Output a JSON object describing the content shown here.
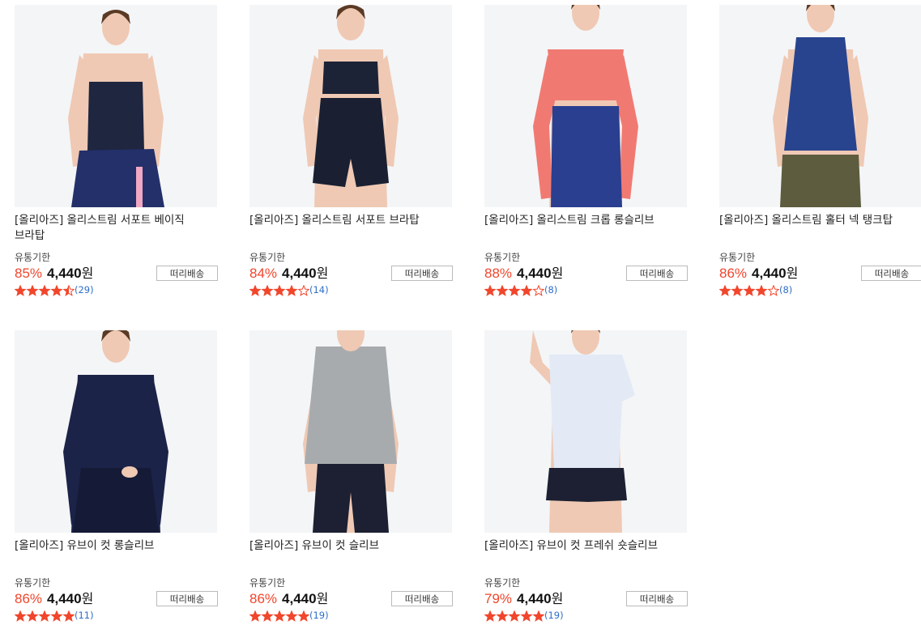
{
  "colors": {
    "accent": "#f1462c",
    "star": "#f1462c",
    "count": "#2e6ec8"
  },
  "products": [
    {
      "title": "[올리아즈] 올리스트림 서포트 베이직 브라탑",
      "expiry": "유통기한",
      "discount": "85%",
      "price": "4,440",
      "currency": "원",
      "ship": "떠리배송",
      "rating": 4.5,
      "count": "(29)",
      "garment": "navy-cami"
    },
    {
      "title": "[올리아즈] 올리스트림 서포트 브라탑",
      "expiry": "유통기한",
      "discount": "84%",
      "price": "4,440",
      "currency": "원",
      "ship": "떠리배송",
      "rating": 4,
      "count": "(14)",
      "garment": "navy-bra-shorts"
    },
    {
      "title": "[올리아즈] 올리스트림 크롭 롱슬리브",
      "expiry": "유통기한",
      "discount": "88%",
      "price": "4,440",
      "currency": "원",
      "ship": "떠리배송",
      "rating": 4,
      "count": "(8)",
      "garment": "coral-crop"
    },
    {
      "title": "[올리아즈] 올리스트림 홀터 넥 탱크탑",
      "expiry": "유통기한",
      "discount": "86%",
      "price": "4,440",
      "currency": "원",
      "ship": "떠리배송",
      "rating": 4,
      "count": "(8)",
      "garment": "blue-halter"
    },
    {
      "title": "[올리아즈] 유브이 컷 롱슬리브",
      "expiry": "유통기한",
      "discount": "86%",
      "price": "4,440",
      "currency": "원",
      "ship": "떠리배송",
      "rating": 5,
      "count": "(11)",
      "garment": "navy-longsleeve"
    },
    {
      "title": "[올리아즈] 유브이 컷 슬리브",
      "expiry": "유통기한",
      "discount": "86%",
      "price": "4,440",
      "currency": "원",
      "ship": "떠리배송",
      "rating": 5,
      "count": "(19)",
      "garment": "grey-sleeveless"
    },
    {
      "title": "[올리아즈] 유브이 컷 프레쉬 숏슬리브",
      "expiry": "유통기한",
      "discount": "79%",
      "price": "4,440",
      "currency": "원",
      "ship": "떠리배송",
      "rating": 5,
      "count": "(19)",
      "garment": "white-tee"
    }
  ]
}
